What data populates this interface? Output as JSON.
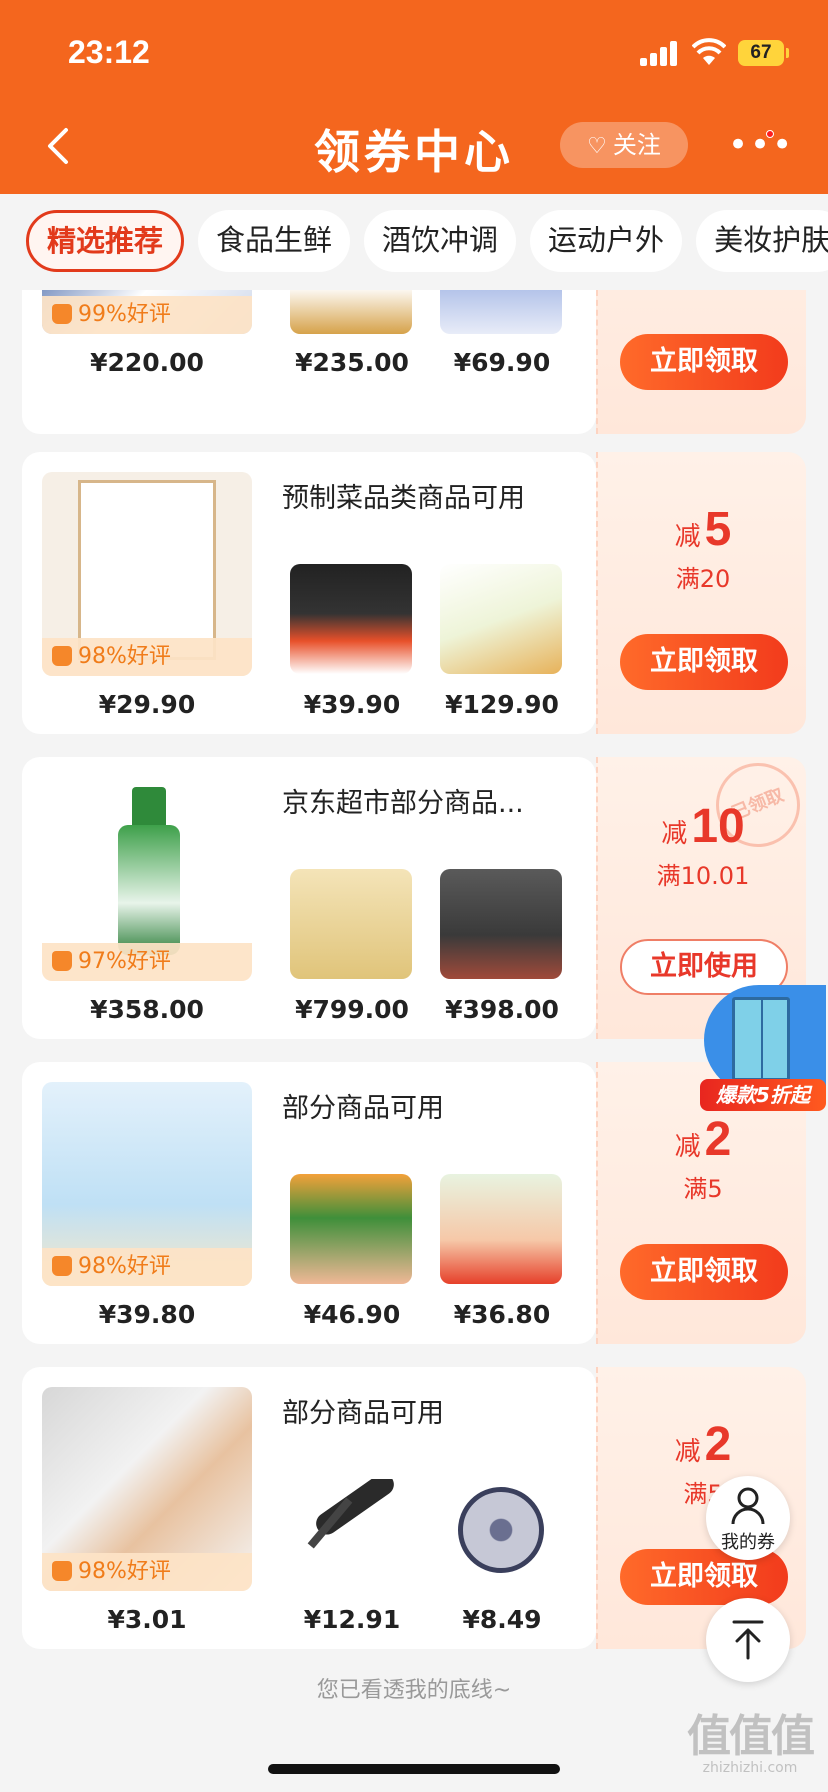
{
  "status": {
    "time": "23:12",
    "battery": "67"
  },
  "nav": {
    "title": "领券中心",
    "follow_label": "关注",
    "follow_icon": "heart-plus-icon",
    "more_icon": "more-dots-icon",
    "more_glyph": "•••"
  },
  "tabs": [
    "精选推荐",
    "食品生鲜",
    "酒饮冲调",
    "运动户外",
    "美妆护肤"
  ],
  "cards": [
    {
      "title": "",
      "products": [
        {
          "price": "¥220.00",
          "rating": "99%好评"
        },
        {
          "price": "¥235.00"
        },
        {
          "price": "¥69.90"
        }
      ],
      "deal_prefix": "",
      "deal_amount": "",
      "deal_threshold": "",
      "button": "立即领取"
    },
    {
      "title": "预制菜品类商品可用",
      "products": [
        {
          "price": "¥29.90",
          "rating": "98%好评"
        },
        {
          "price": "¥39.90"
        },
        {
          "price": "¥129.90"
        }
      ],
      "deal_prefix": "减",
      "deal_amount": "5",
      "deal_threshold": "满20",
      "button": "立即领取"
    },
    {
      "title": "京东超市部分商品...",
      "products": [
        {
          "price": "¥358.00",
          "rating": "97%好评"
        },
        {
          "price": "¥799.00"
        },
        {
          "price": "¥398.00"
        }
      ],
      "deal_prefix": "减",
      "deal_amount": "10",
      "deal_threshold": "满10.01",
      "stamp": "已领取",
      "button": "立即使用"
    },
    {
      "title": "部分商品可用",
      "products": [
        {
          "price": "¥39.80",
          "rating": "98%好评"
        },
        {
          "price": "¥46.90"
        },
        {
          "price": "¥36.80"
        }
      ],
      "deal_prefix": "减",
      "deal_amount": "2",
      "deal_threshold": "满5",
      "button": "立即领取"
    },
    {
      "title": "部分商品可用",
      "products": [
        {
          "price": "¥3.01",
          "rating": "98%好评"
        },
        {
          "price": "¥12.91"
        },
        {
          "price": "¥8.49"
        }
      ],
      "deal_prefix": "减",
      "deal_amount": "2",
      "deal_threshold": "满5",
      "button": "立即领取"
    }
  ],
  "footer": "您已看透我的底线~",
  "floating": {
    "ad_tag": "爆款5折起",
    "my_coupon": "我的券"
  },
  "watermark": {
    "big": "值值值",
    "small": "zhizhizhi.com"
  },
  "colors": {
    "brand": "#f4661e",
    "accent": "#e8382a",
    "rating": "#f07c1a"
  }
}
